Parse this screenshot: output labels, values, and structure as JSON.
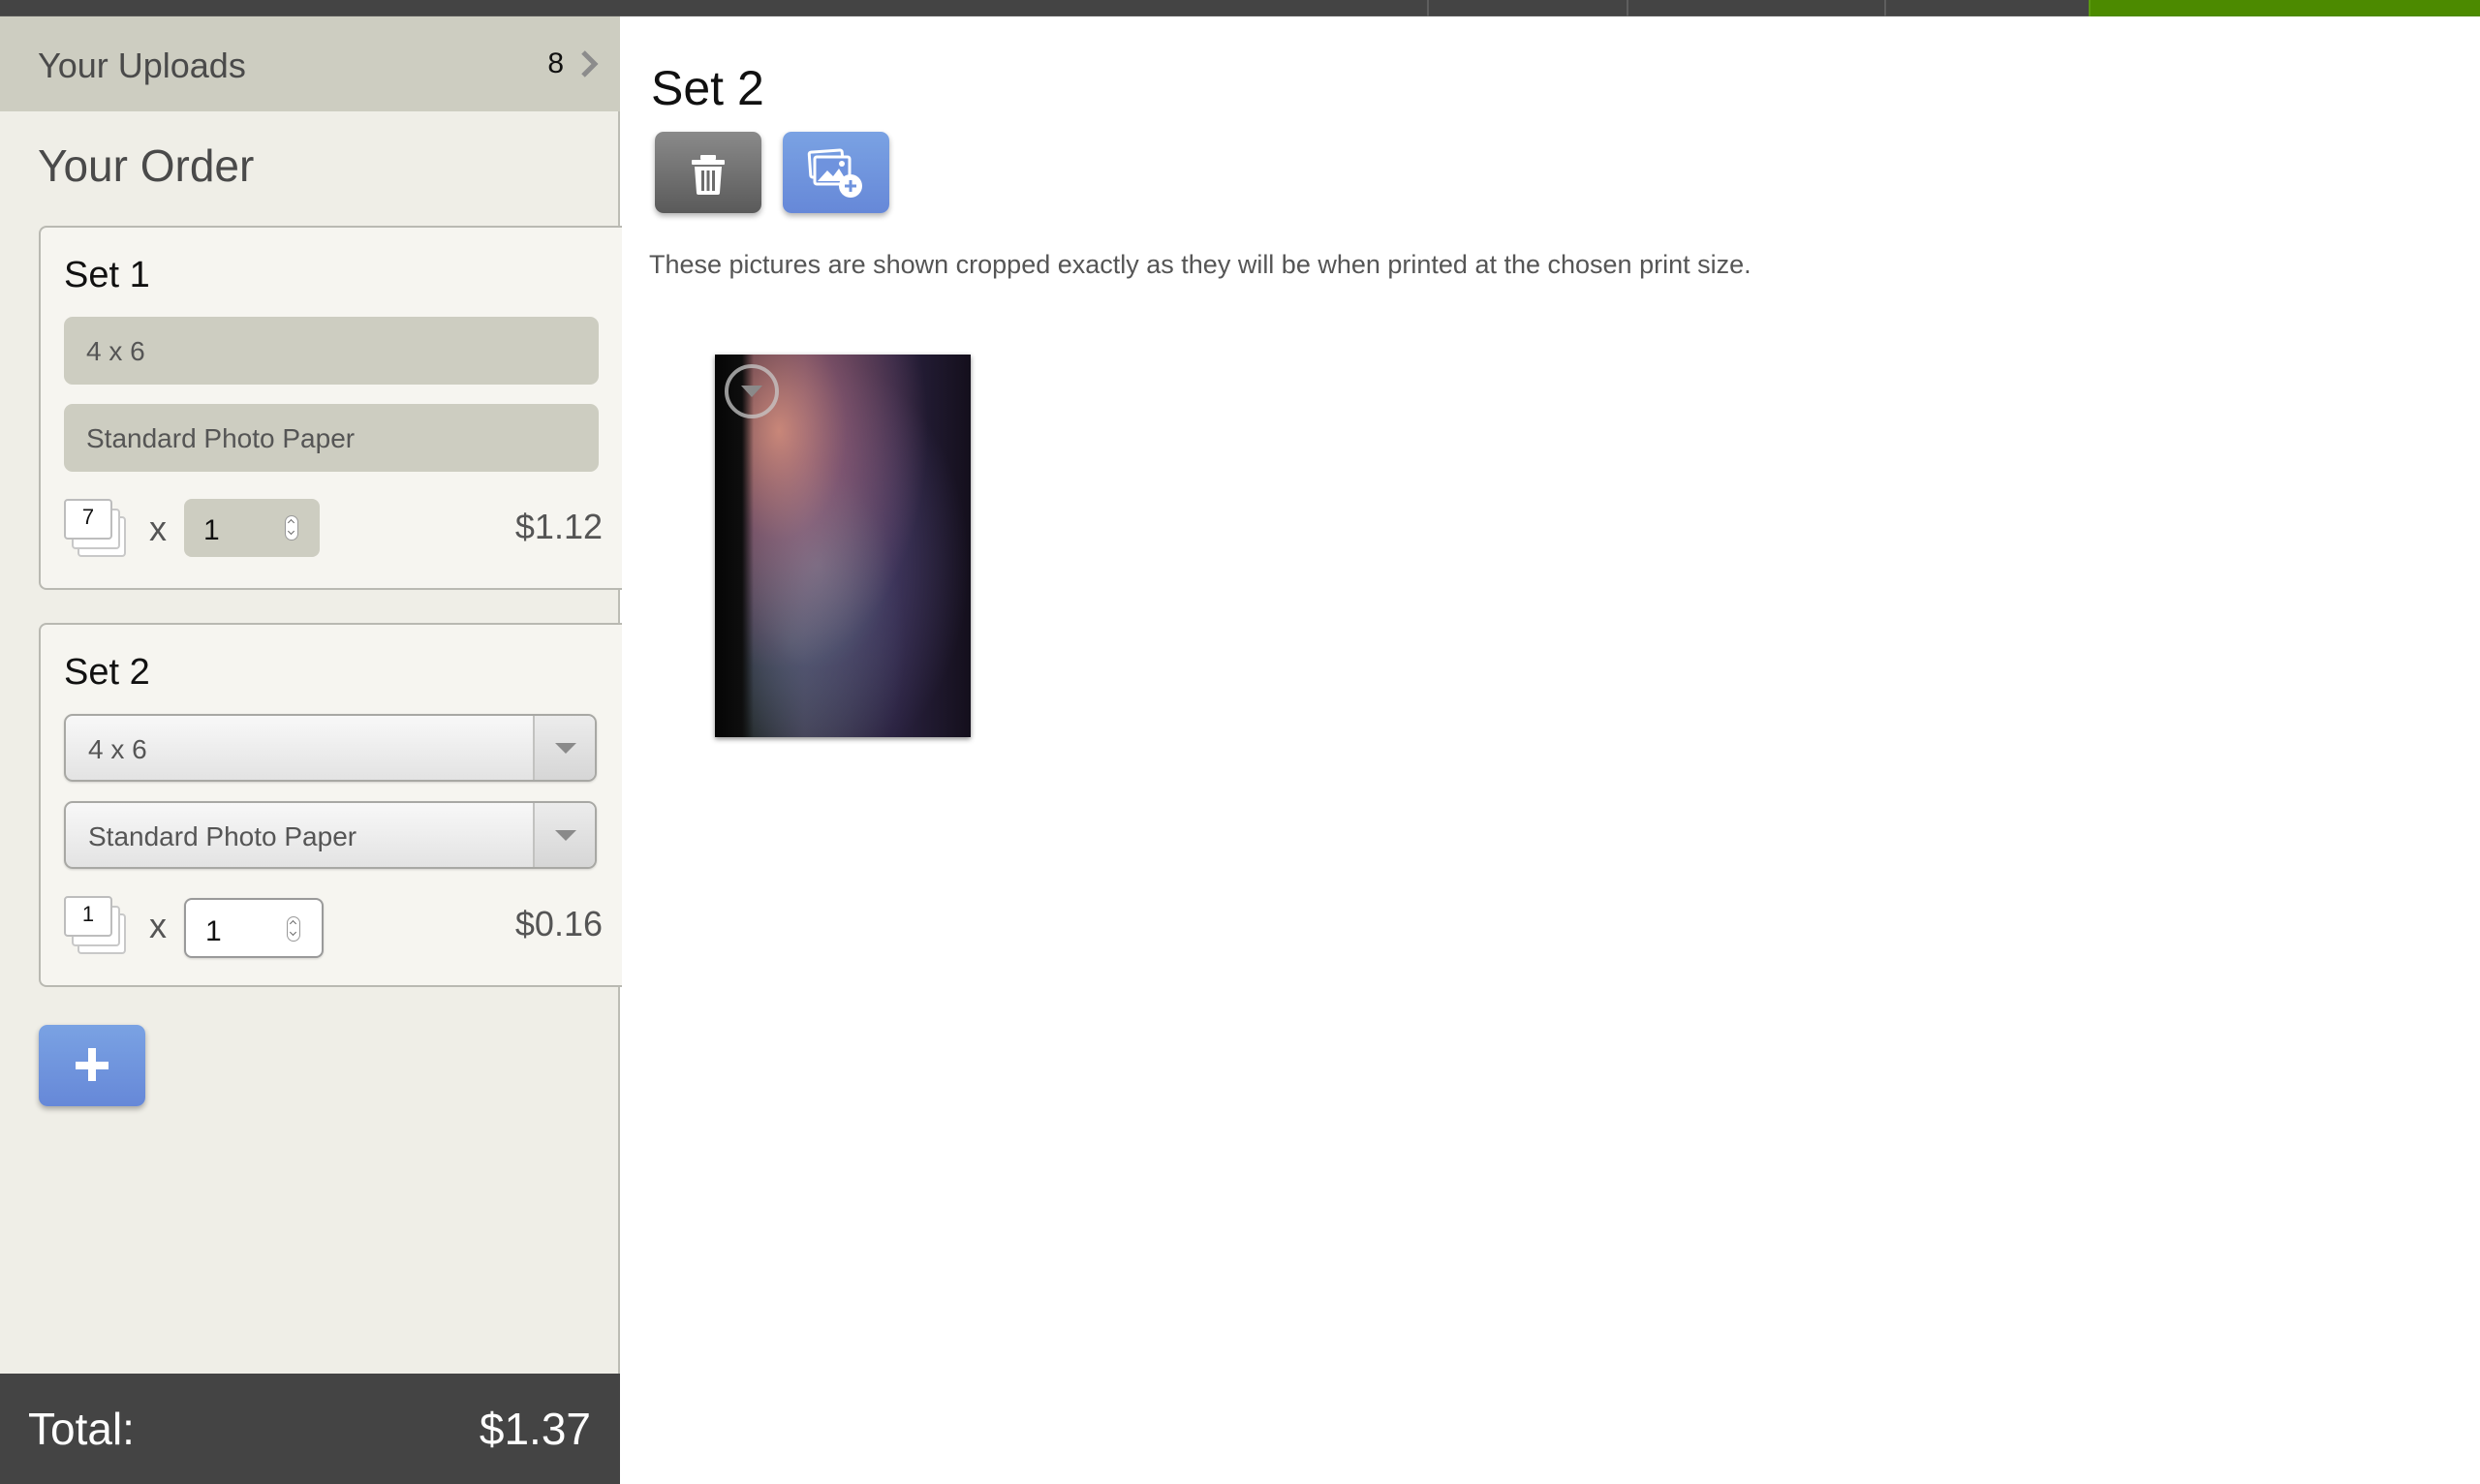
{
  "topbar": {
    "accent_color": "#4c8a00",
    "segments": [
      "",
      "",
      "",
      ""
    ]
  },
  "sidebar": {
    "uploads": {
      "label": "Your Uploads",
      "count": "8",
      "icon": "chevron-right-icon"
    },
    "order_title": "Your Order",
    "sets": [
      {
        "title": "Set 1",
        "size": "4 x 6",
        "paper": "Standard Photo Paper",
        "photo_count": "7",
        "times": "x",
        "quantity": "1",
        "price": "$1.12",
        "editable": false
      },
      {
        "title": "Set 2",
        "size": "4 x 6",
        "paper": "Standard Photo Paper",
        "photo_count": "1",
        "times": "x",
        "quantity": "1",
        "price": "$0.16",
        "editable": true
      }
    ],
    "add_set_button": {
      "icon": "plus-icon"
    },
    "total": {
      "label": "Total:",
      "value": "$1.37"
    }
  },
  "main": {
    "heading": "Set 2",
    "toolbar": {
      "delete_icon": "trash-icon",
      "add_photos_icon": "add-photos-icon"
    },
    "description": "These pictures are shown cropped exactly as they will be when printed at the chosen print size.",
    "photos": [
      {
        "alt": "aurora photo",
        "menu_icon": "dropdown-menu-icon"
      }
    ]
  },
  "colors": {
    "primary_blue": "#6f93de",
    "dark_gray": "#444444",
    "sidebar_bg": "#efeee7",
    "field_bg": "#cdcdc1"
  }
}
